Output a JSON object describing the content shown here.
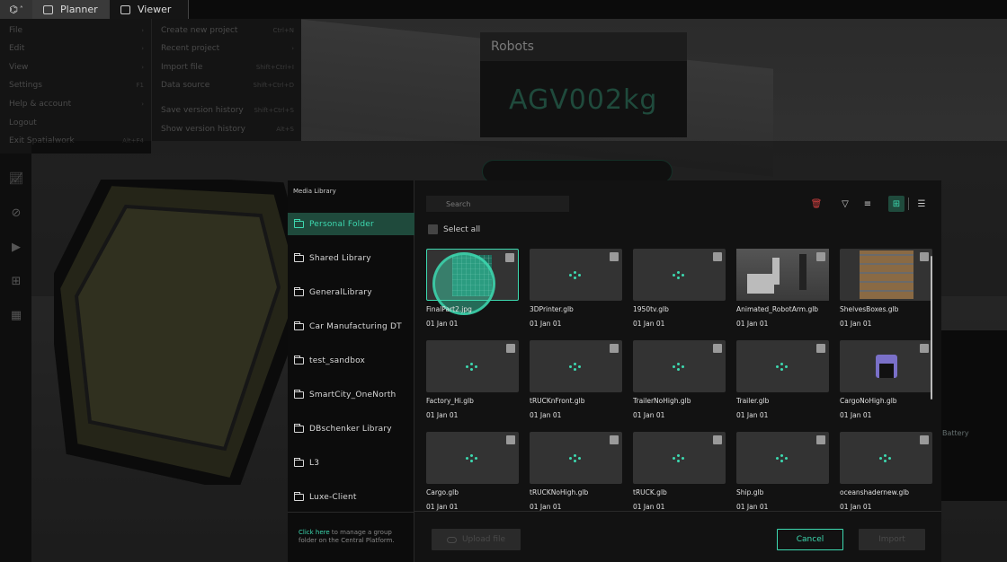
{
  "topbar": {
    "tabs": [
      {
        "label": "Planner"
      },
      {
        "label": "Viewer"
      }
    ]
  },
  "file_menu": {
    "items": [
      {
        "label": "File",
        "shortcut": "›"
      },
      {
        "label": "Edit",
        "shortcut": "›"
      },
      {
        "label": "View",
        "shortcut": "›"
      },
      {
        "label": "Settings",
        "shortcut": "F1"
      },
      {
        "label": "Help & account",
        "shortcut": "›"
      },
      {
        "label": "Logout",
        "shortcut": ""
      },
      {
        "label": "Exit Spatialwork",
        "shortcut": "Alt+F4"
      }
    ],
    "submenu": [
      {
        "label": "Create new project",
        "shortcut": "Ctrl+N"
      },
      {
        "label": "Recent project",
        "shortcut": "›"
      },
      {
        "label": "Import file",
        "shortcut": "Shift+Ctrl+I"
      },
      {
        "label": "Data source",
        "shortcut": "Shift+Ctrl+D"
      },
      {
        "label": "Save version history",
        "shortcut": "Shift+Ctrl+S"
      },
      {
        "label": "Show version history",
        "shortcut": "Alt+S"
      }
    ]
  },
  "robots_panel": {
    "title": "Robots",
    "value": "AGV002kg"
  },
  "scene": {
    "battery_label": "Battery"
  },
  "media_library": {
    "title": "Media Library",
    "folders": [
      {
        "label": "Personal Folder"
      },
      {
        "label": "Shared Library"
      },
      {
        "label": "GeneralLibrary"
      },
      {
        "label": "Car Manufacturing DT"
      },
      {
        "label": "test_sandbox"
      },
      {
        "label": "SmartCity_OneNorth"
      },
      {
        "label": "DBschenker Library"
      },
      {
        "label": "L3"
      },
      {
        "label": "Luxe-Client"
      }
    ],
    "footer_link": "Click here",
    "footer_text": " to manage a group folder on the Central Platform.",
    "search_placeholder": "Search",
    "select_all": "Select all",
    "files": [
      {
        "name": "FinalPart2.jpg",
        "date": "01 Jan 01"
      },
      {
        "name": "3DPrinter.glb",
        "date": "01 Jan 01"
      },
      {
        "name": "1950tv.glb",
        "date": "01 Jan 01"
      },
      {
        "name": "Animated_RobotArm.glb",
        "date": "01 Jan 01"
      },
      {
        "name": "ShelvesBoxes.glb",
        "date": "01 Jan 01"
      },
      {
        "name": "Factory_Hi.glb",
        "date": "01 Jan 01"
      },
      {
        "name": "tRUCKnFront.glb",
        "date": "01 Jan 01"
      },
      {
        "name": "TrailerNoHigh.glb",
        "date": "01 Jan 01"
      },
      {
        "name": "Trailer.glb",
        "date": "01 Jan 01"
      },
      {
        "name": "CargoNoHigh.glb",
        "date": "01 Jan 01"
      },
      {
        "name": "Cargo.glb",
        "date": "01 Jan 01"
      },
      {
        "name": "tRUCKNoHigh.glb",
        "date": "01 Jan 01"
      },
      {
        "name": "tRUCK.glb",
        "date": "01 Jan 01"
      },
      {
        "name": "Ship.glb",
        "date": "01 Jan 01"
      },
      {
        "name": "oceanshadernew.glb",
        "date": "01 Jan 01"
      }
    ],
    "buttons": {
      "upload": "Upload file",
      "cancel": "Cancel",
      "import": "Import"
    }
  },
  "colors": {
    "accent": "#3dd9b0",
    "accent_dark": "#1f4a3c",
    "danger": "#d04040"
  }
}
